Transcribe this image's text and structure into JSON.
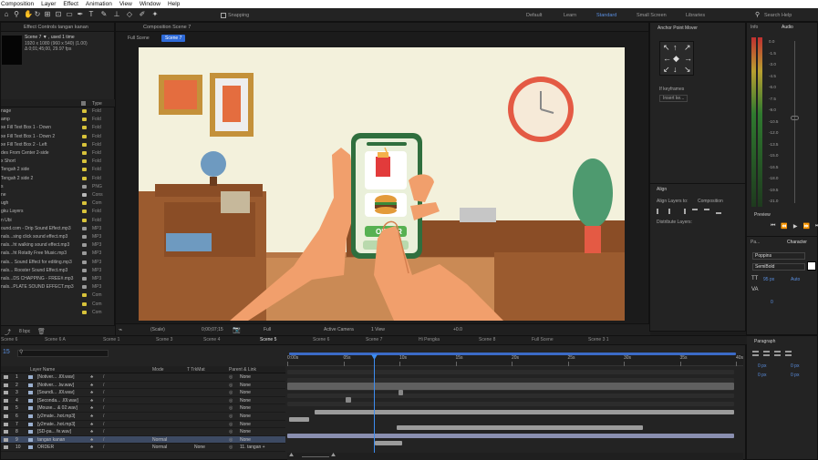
{
  "menu": [
    "Composition",
    "Layer",
    "Effect",
    "Animation",
    "View",
    "Window",
    "Help"
  ],
  "toolbar": {
    "snapping": "Snapping",
    "workspaces": [
      "Default",
      "Learn",
      "Standard",
      "Small Screen",
      "Libraries"
    ],
    "active_workspace": "Standard",
    "search": "Search Help"
  },
  "project": {
    "tab": "Effect Controls tangan kanan",
    "comp_name": "Scene 7 ▼ , used 1 time",
    "comp_info": [
      "1920 x 1080  (960 x 540) (1.00)",
      "Δ 0;01;45;00, 29.97 fps"
    ],
    "col_name": "Name",
    "col_type": "Type",
    "rows": [
      {
        "name": "nage",
        "color": "#d7c23a",
        "type": "Fold"
      },
      {
        "name": "amp",
        "color": "#d7c23a",
        "type": "Fold"
      },
      {
        "name": "xe Fill Text Box 1 - Down",
        "color": "#d7c23a",
        "type": "Fold"
      },
      {
        "name": "xe Fill Text Box 1 - Down 2",
        "color": "#d7c23a",
        "type": "Fold"
      },
      {
        "name": "xe Fill Text Box 2 - Left",
        "color": "#d7c23a",
        "type": "Fold"
      },
      {
        "name": "des From Center 2-side",
        "color": "#d7c23a",
        "type": "Fold"
      },
      {
        "name": "x Short",
        "color": "#d7c23a",
        "type": "Fold"
      },
      {
        "name": "Tengah 2 side",
        "color": "#d7c23a",
        "type": "Fold"
      },
      {
        "name": "Tengah 2 side 2",
        "color": "#d7c23a",
        "type": "Fold"
      },
      {
        "name": "s",
        "color": "#9a9a9a",
        "type": "PNG"
      },
      {
        "name": "ne",
        "color": "#b8b8b8",
        "type": "Cons"
      },
      {
        "name": "ugh",
        "color": "#d7c23a",
        "type": "Com"
      },
      {
        "name": "gku Layers",
        "color": "#d7c23a",
        "type": "Fold"
      },
      {
        "name": "n Ubi",
        "color": "#d7c23a",
        "type": "Fold"
      },
      {
        "name": "ound.com - Drip Sound Effect.mp3",
        "color": "#9a9a9a",
        "type": "MP3"
      },
      {
        "name": "nals...sing click sound effect.mp3",
        "color": "#9a9a9a",
        "type": "MP3"
      },
      {
        "name": "nals...ht walking sound effect.mp3",
        "color": "#9a9a9a",
        "type": "MP3"
      },
      {
        "name": "nals...ht Rotatty Free Music.mp3",
        "color": "#9a9a9a",
        "type": "MP3"
      },
      {
        "name": "nals... Sound Effect for editing.mp3",
        "color": "#9a9a9a",
        "type": "MP3"
      },
      {
        "name": "nals... Rooster Sound Effect.mp3",
        "color": "#9a9a9a",
        "type": "MP3"
      },
      {
        "name": "nals...DS CHAPPING - FREE#.mp3",
        "color": "#9a9a9a",
        "type": "MP3"
      },
      {
        "name": "nals...PLATE SOUND EFFECT.mp3",
        "color": "#9a9a9a",
        "type": "MP3"
      },
      {
        "name": "",
        "color": "#d7c23a",
        "type": "Com"
      },
      {
        "name": "",
        "color": "#d7c23a",
        "type": "Com"
      },
      {
        "name": "",
        "color": "#d7c23a",
        "type": "Com"
      }
    ],
    "bpc": "8 bpc"
  },
  "viewer": {
    "tab": "Composition Scene 7",
    "breadcrumbs": [
      "Full Scene",
      "Scene 7"
    ],
    "zoom": "(Scale)",
    "timecode": "0;00;07;15",
    "resolution": "Full",
    "camera": "Active Camera",
    "views": "1 View",
    "exposure": "+0.0",
    "order_label": "ORDER"
  },
  "anchor_panel": {
    "title": "Anchor Point Mover",
    "keyframes": "If keyframes",
    "insert": "Insert ke..."
  },
  "align_panel": {
    "title": "Align",
    "align_to": "Align Layers to:",
    "align_target": "Composition",
    "distribute": "Distribute Layers:"
  },
  "info_audio": {
    "tabs": [
      "Info",
      "Audio"
    ],
    "meter": [
      "0.0",
      "-1.5",
      "-3.0",
      "-4.5",
      "-6.0",
      "-7.5",
      "-9.0",
      "-10.5",
      "-12.0",
      "-13.5",
      "-15.0",
      "-16.5",
      "-18.0",
      "-19.5",
      "-21.0"
    ]
  },
  "preview": {
    "title": "Preview"
  },
  "character": {
    "tabs": [
      "Pa...",
      "Character"
    ],
    "font": "Poppins",
    "style": "SemiBold",
    "size": "95 px",
    "leading": "Auto",
    "tracking": "0"
  },
  "paragraph": {
    "title": "Paragraph",
    "indent": "0 px"
  },
  "timeline": {
    "tabs": [
      "Scene 6",
      "Scene 6 A",
      "Scene 1",
      "Scene 3",
      "Scene 4",
      "Scene 5",
      "Scene 6",
      "Scene 7",
      "Hi Pengka",
      "Scene 8",
      "Full Scene",
      "Scene 3 1"
    ],
    "active_tab": "Scene 5",
    "timecode": "15",
    "col_layer": "Layer Name",
    "col_mode": "Mode",
    "col_trkmat": "T  TrkMat",
    "col_parent": "Parent & Link",
    "ruler": [
      "0:00s",
      "05s",
      "10s",
      "15s",
      "20s",
      "25s",
      "30s",
      "35s",
      "40s"
    ],
    "layers": [
      {
        "num": "1",
        "name": "[Notiver... .l0l.wav]",
        "parent": "None",
        "sel": false
      },
      {
        "num": "2",
        "name": "[Notiver... .lw.wav]",
        "parent": "None",
        "sel": false
      },
      {
        "num": "3",
        "name": "[Soundi... .l0l.wav]",
        "parent": "None",
        "sel": false
      },
      {
        "num": "4",
        "name": "[Seconda... .l0l.wav]",
        "parent": "None",
        "sel": false
      },
      {
        "num": "5",
        "name": "[Mouse... & 02.wav]",
        "parent": "None",
        "sel": false
      },
      {
        "num": "6",
        "name": "[y2mate...hot.mp3]",
        "parent": "None",
        "sel": false
      },
      {
        "num": "7",
        "name": "[y2mate...hot.mp3]",
        "parent": "None",
        "sel": false
      },
      {
        "num": "8",
        "name": "[SD-pa... fe.wav]",
        "parent": "None",
        "sel": false
      },
      {
        "num": "9",
        "name": "tangan kanan",
        "mode": "Normal",
        "parent": "None",
        "sel": true
      },
      {
        "num": "10",
        "name": "ORDER",
        "mode": "Normal",
        "trkmat": "None",
        "parent": "11. tangan +",
        "sel": false
      }
    ]
  },
  "colors": {
    "accent": "#2e6ad8",
    "playhead": "#3d8cf0",
    "canvas_bg": "#f3f1dc",
    "phone": "#2f6f3e"
  }
}
